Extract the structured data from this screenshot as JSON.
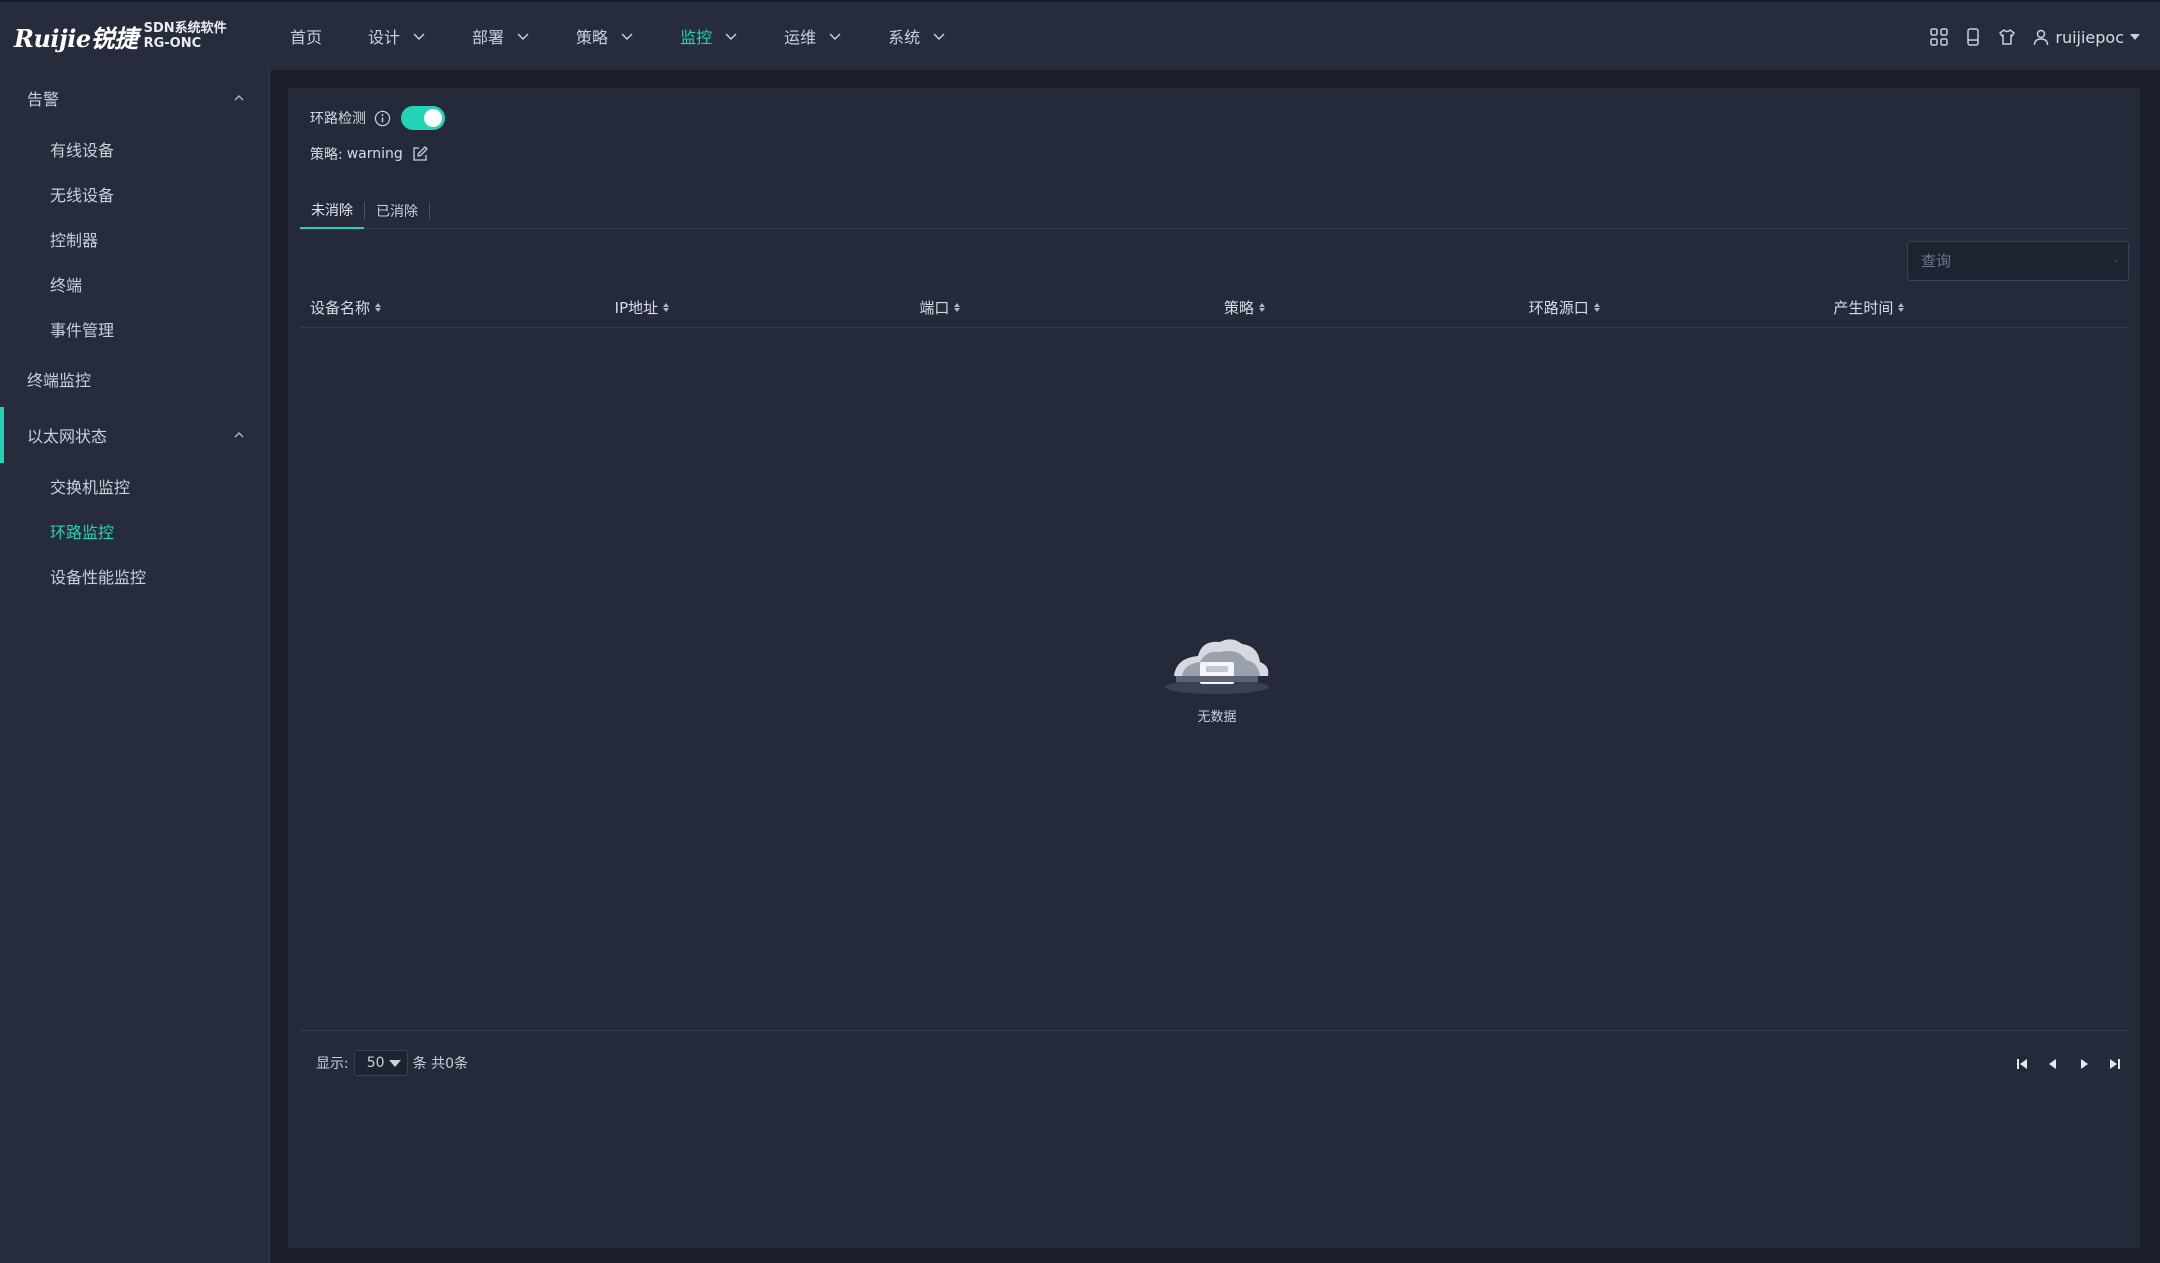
{
  "brand": {
    "logo": "Ruijie锐捷",
    "line1": "SDN系统软件",
    "line2": "RG-ONC"
  },
  "nav": [
    {
      "label": "首页",
      "dropdown": false
    },
    {
      "label": "设计",
      "dropdown": true
    },
    {
      "label": "部署",
      "dropdown": true
    },
    {
      "label": "策略",
      "dropdown": true
    },
    {
      "label": "监控",
      "dropdown": true,
      "active": true
    },
    {
      "label": "运维",
      "dropdown": true
    },
    {
      "label": "系统",
      "dropdown": true
    }
  ],
  "top_icons": [
    "apps-grid-icon",
    "tablet-icon",
    "shirt-icon"
  ],
  "user": {
    "name": "ruijiepoc"
  },
  "sidebar": {
    "groups": [
      {
        "label": "告警",
        "expanded": true,
        "items": [
          "有线设备",
          "无线设备",
          "控制器",
          "终端",
          "事件管理"
        ]
      },
      {
        "label": "终端监控",
        "expanded": false,
        "items": []
      },
      {
        "label": "以太网状态",
        "expanded": true,
        "active": true,
        "items": [
          "交换机监控",
          "环路监控",
          "设备性能监控"
        ],
        "active_item": "环路监控"
      }
    ]
  },
  "main": {
    "loop_detect_label": "环路检测",
    "loop_detect_enabled": true,
    "policy_prefix": "策略:",
    "policy_value": "warning",
    "tabs": [
      {
        "label": "未消除",
        "active": true
      },
      {
        "label": "已消除",
        "active": false
      }
    ],
    "search_placeholder": "查询",
    "columns": [
      "设备名称",
      "IP地址",
      "端口",
      "策略",
      "环路源口",
      "产生时间"
    ],
    "rows": [],
    "empty_text": "无数据",
    "pagination": {
      "show_label": "显示:",
      "page_size": "50",
      "total_text": "条 共0条"
    }
  },
  "colors": {
    "accent": "#22d3b6",
    "topbar": "#262c3c",
    "content": "#242a39",
    "background": "#1b1f2b"
  }
}
